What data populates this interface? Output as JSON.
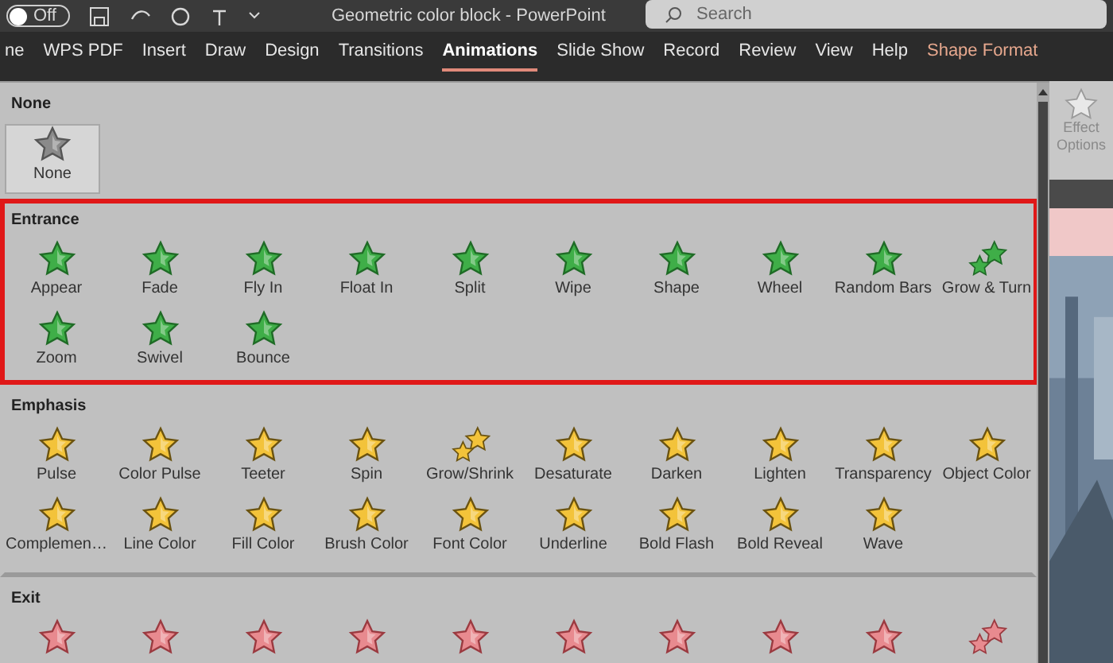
{
  "title_bar": {
    "autosave_label": "Off",
    "title": "Geometric color block - PowerPoint",
    "search": {
      "placeholder": "Search"
    }
  },
  "tabs": [
    {
      "label": "ne",
      "selected": false,
      "kind": "normal"
    },
    {
      "label": "WPS PDF",
      "selected": false,
      "kind": "normal"
    },
    {
      "label": "Insert",
      "selected": false,
      "kind": "normal"
    },
    {
      "label": "Draw",
      "selected": false,
      "kind": "normal"
    },
    {
      "label": "Design",
      "selected": false,
      "kind": "normal"
    },
    {
      "label": "Transitions",
      "selected": false,
      "kind": "normal"
    },
    {
      "label": "Animations",
      "selected": true,
      "kind": "normal"
    },
    {
      "label": "Slide Show",
      "selected": false,
      "kind": "normal"
    },
    {
      "label": "Record",
      "selected": false,
      "kind": "normal"
    },
    {
      "label": "Review",
      "selected": false,
      "kind": "normal"
    },
    {
      "label": "View",
      "selected": false,
      "kind": "normal"
    },
    {
      "label": "Help",
      "selected": false,
      "kind": "normal"
    },
    {
      "label": "Shape Format",
      "selected": false,
      "kind": "contextual"
    }
  ],
  "gallery": {
    "sections": [
      {
        "title": "None",
        "kind": "none",
        "highlighted": false,
        "effects": [
          {
            "label": "None",
            "kind": "single",
            "selected": true
          }
        ]
      },
      {
        "title": "Entrance",
        "kind": "entrance",
        "highlighted": true,
        "effects": [
          {
            "label": "Appear",
            "kind": "single",
            "selected": false
          },
          {
            "label": "Fade",
            "kind": "single",
            "selected": false
          },
          {
            "label": "Fly In",
            "kind": "single",
            "selected": false
          },
          {
            "label": "Float In",
            "kind": "single",
            "selected": false
          },
          {
            "label": "Split",
            "kind": "single",
            "selected": false
          },
          {
            "label": "Wipe",
            "kind": "single",
            "selected": false
          },
          {
            "label": "Shape",
            "kind": "single",
            "selected": false
          },
          {
            "label": "Wheel",
            "kind": "single",
            "selected": false
          },
          {
            "label": "Random Bars",
            "kind": "single",
            "selected": false
          },
          {
            "label": "Grow & Turn",
            "kind": "pair",
            "selected": false
          },
          {
            "label": "Zoom",
            "kind": "single",
            "selected": false
          },
          {
            "label": "Swivel",
            "kind": "single",
            "selected": false
          },
          {
            "label": "Bounce",
            "kind": "single",
            "selected": false
          }
        ]
      },
      {
        "title": "Emphasis",
        "kind": "emphasis",
        "highlighted": false,
        "effects": [
          {
            "label": "Pulse",
            "kind": "single",
            "selected": false
          },
          {
            "label": "Color Pulse",
            "kind": "single",
            "selected": false
          },
          {
            "label": "Teeter",
            "kind": "single",
            "selected": false
          },
          {
            "label": "Spin",
            "kind": "single",
            "selected": false
          },
          {
            "label": "Grow/Shrink",
            "kind": "pair",
            "selected": false
          },
          {
            "label": "Desaturate",
            "kind": "single",
            "selected": false
          },
          {
            "label": "Darken",
            "kind": "single",
            "selected": false
          },
          {
            "label": "Lighten",
            "kind": "single",
            "selected": false
          },
          {
            "label": "Transparency",
            "kind": "single",
            "selected": false
          },
          {
            "label": "Object Color",
            "kind": "single",
            "selected": false
          },
          {
            "label": "Complemen…",
            "kind": "single",
            "selected": false
          },
          {
            "label": "Line Color",
            "kind": "single",
            "selected": false
          },
          {
            "label": "Fill Color",
            "kind": "single",
            "selected": false
          },
          {
            "label": "Brush Color",
            "kind": "single",
            "selected": false
          },
          {
            "label": "Font Color",
            "kind": "single",
            "selected": false
          },
          {
            "label": "Underline",
            "kind": "single",
            "selected": false
          },
          {
            "label": "Bold Flash",
            "kind": "single",
            "selected": false
          },
          {
            "label": "Bold Reveal",
            "kind": "single",
            "selected": false
          },
          {
            "label": "Wave",
            "kind": "single",
            "selected": false
          }
        ]
      },
      {
        "title": "Exit",
        "kind": "exit",
        "highlighted": false,
        "effects": [
          {
            "kind": "single",
            "selected": false
          },
          {
            "kind": "single",
            "selected": false
          },
          {
            "kind": "single",
            "selected": false
          },
          {
            "kind": "single",
            "selected": false
          },
          {
            "kind": "single",
            "selected": false
          },
          {
            "kind": "single",
            "selected": false
          },
          {
            "kind": "single",
            "selected": false
          },
          {
            "kind": "single",
            "selected": false
          },
          {
            "kind": "single",
            "selected": false
          },
          {
            "kind": "pair",
            "selected": false
          }
        ]
      }
    ]
  },
  "effect_options": {
    "label": "Effect Options",
    "disabled": true
  }
}
